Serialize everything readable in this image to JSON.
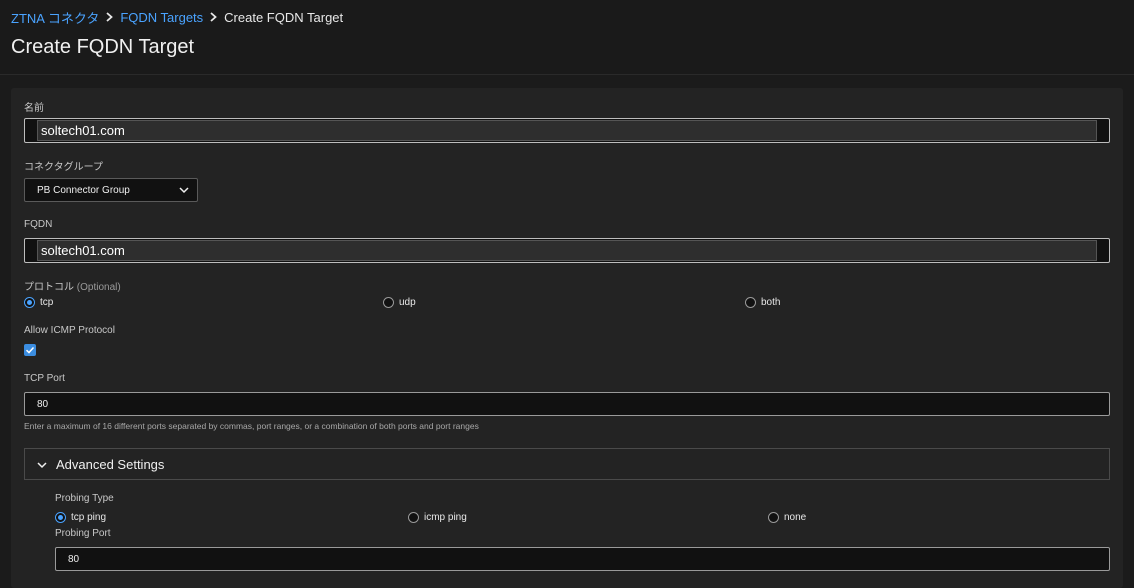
{
  "breadcrumb": {
    "items": [
      "ZTNA コネクタ",
      "FQDN Targets"
    ],
    "current": "Create FQDN Target"
  },
  "page": {
    "title": "Create FQDN Target"
  },
  "form": {
    "name": {
      "label": "名前",
      "value": "soltech01.com"
    },
    "connector_group": {
      "label": "コネクタグループ",
      "value": "PB Connector Group"
    },
    "fqdn": {
      "label": "FQDN",
      "value": "soltech01.com"
    },
    "protocol": {
      "label": "プロトコル",
      "optional": "(Optional)",
      "options": [
        "tcp",
        "udp",
        "both"
      ],
      "selected": "tcp"
    },
    "icmp": {
      "label": "Allow ICMP Protocol",
      "checked": true
    },
    "tcp_port": {
      "label": "TCP Port",
      "value": "80",
      "helper": "Enter a maximum of 16 different ports separated by commas, port ranges, or a combination of both ports and port ranges"
    },
    "advanced": {
      "title": "Advanced Settings",
      "probing_type": {
        "label": "Probing Type",
        "options": [
          "tcp ping",
          "icmp ping",
          "none"
        ],
        "selected": "tcp ping"
      },
      "probing_port": {
        "label": "Probing Port",
        "value": "80"
      }
    }
  },
  "colors": {
    "accent": "#4aa3ff",
    "checkbox": "#3b8de0",
    "background": "#1b1b1b"
  },
  "icons": [
    "chevron-right-icon",
    "chevron-down-icon",
    "check-icon"
  ]
}
